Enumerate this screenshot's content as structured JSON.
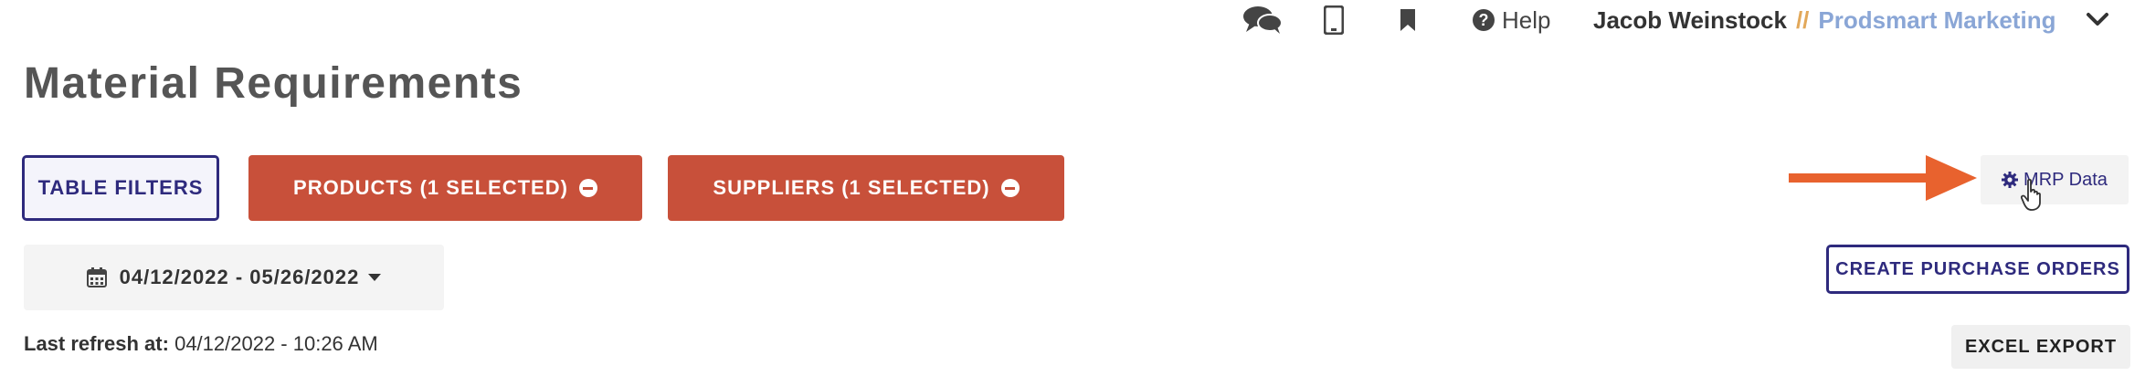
{
  "topbar": {
    "icons": [
      "chat-icon",
      "mobile-icon",
      "bookmark-icon",
      "help-icon"
    ],
    "help_label": "Help",
    "user_name": "Jacob Weinstock",
    "separator": "//",
    "org_name": "Prodsmart Marketing"
  },
  "page": {
    "title": "Material Requirements"
  },
  "filters": {
    "table_filters_label": "TABLE FILTERS",
    "products_label": "PRODUCTS (1 SELECTED)",
    "suppliers_label": "SUPPLIERS (1 SELECTED)",
    "date_range": "04/12/2022 - 05/26/2022"
  },
  "actions": {
    "mrp_data_label": "MRP Data",
    "create_po_label": "CREATE PURCHASE ORDERS",
    "excel_export_label": "EXCEL EXPORT"
  },
  "status": {
    "refresh_label": "Last refresh at:",
    "refresh_value": "04/12/2022 - 10:26 AM"
  },
  "colors": {
    "primary": "#2e2a7d",
    "danger": "#c8503a",
    "arrow": "#e8622e",
    "org_link": "#8aa6d6",
    "separator": "#e2a85a"
  }
}
